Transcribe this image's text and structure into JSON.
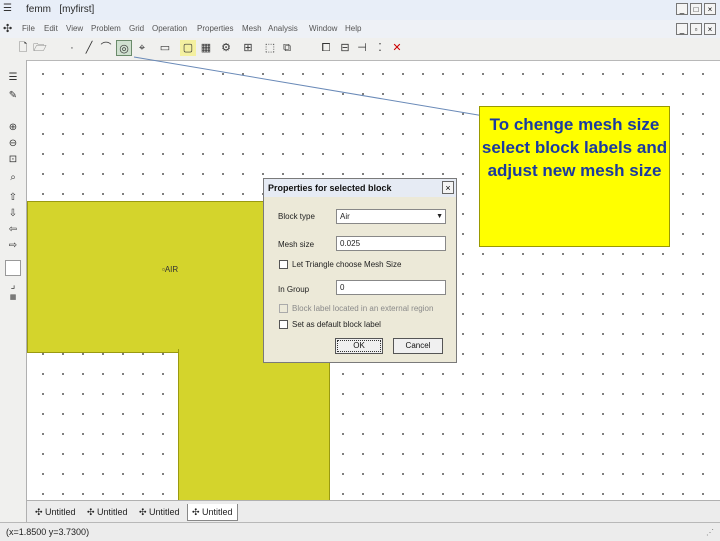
{
  "window": {
    "app_name": "femm",
    "doc_name": "[myfirst]",
    "app_icon": "femm-app-icon",
    "minimize": "_",
    "maximize": "□",
    "close": "×"
  },
  "menu": [
    "File",
    "Edit",
    "View",
    "Problem",
    "Grid",
    "Operation",
    "Properties",
    "Mesh",
    "Analysis",
    "Window",
    "Help"
  ],
  "toolbar_icons": [
    "new-file-icon",
    "open-file-icon",
    "point-mode-icon",
    "segment-mode-icon",
    "arc-mode-icon",
    "block-label-mode-icon",
    "group-mode-icon",
    "bitmap-icon",
    "properties-icon",
    "mesh-icon",
    "run-analysis-icon",
    "view-results-icon",
    "move-icon",
    "copy-icon",
    "mirror-icon",
    "scale-icon",
    "fillet-icon",
    "delete-icon"
  ],
  "left_icons": [
    "list-icon",
    "edit-icon",
    "zoom-in-icon",
    "zoom-out-icon",
    "zoom-window-icon",
    "zoom-natural-icon",
    "pan-up-icon",
    "pan-down-icon",
    "pan-left-icon",
    "pan-right-icon",
    "grid-show-icon",
    "grid-snap-icon",
    "grid-size-icon"
  ],
  "canvas": {
    "block_label": "AIR"
  },
  "callout": {
    "text": "To chenge mesh size select block labels and adjust new mesh size"
  },
  "dialog": {
    "title": "Properties for selected block",
    "close_label": "×",
    "block_type_label": "Block type",
    "block_type_value": "Air",
    "mesh_size_label": "Mesh size",
    "mesh_size_value": "0.025",
    "auto_mesh_label": "Let Triangle choose Mesh Size",
    "group_label": "In Group",
    "group_value": "0",
    "external_label": "Block label located in an external region",
    "default_label": "Set as default block label",
    "ok_label": "OK",
    "cancel_label": "Cancel"
  },
  "tabs": [
    "Untitled",
    "Untitled",
    "Untitled",
    "Untitled"
  ],
  "status": {
    "coords": "(x=1.8500 y=3.7300)"
  },
  "colors": {
    "block_fill": "#d4d42c",
    "callout_bg": "#ffff00",
    "callout_text": "#1a3aa0"
  }
}
